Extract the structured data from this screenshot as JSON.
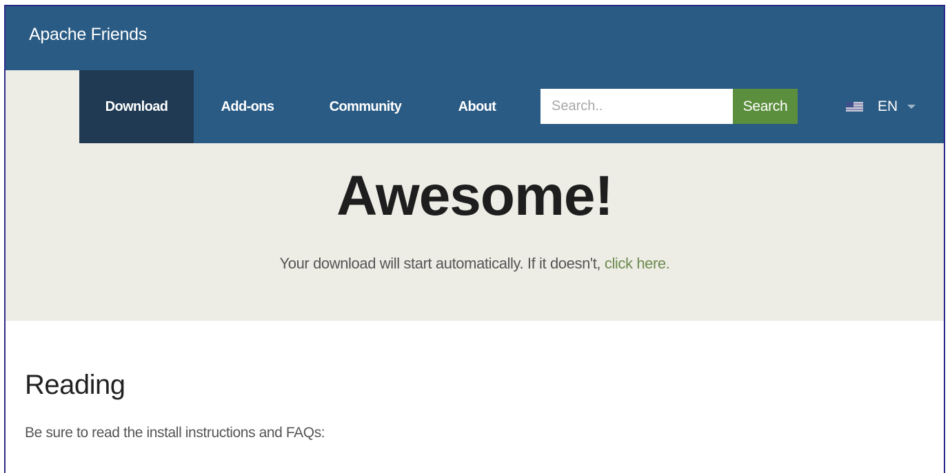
{
  "header": {
    "brand": "Apache Friends"
  },
  "nav": {
    "items": [
      {
        "label": "Download",
        "active": true
      },
      {
        "label": "Add-ons",
        "active": false
      },
      {
        "label": "Community",
        "active": false
      },
      {
        "label": "About",
        "active": false
      }
    ],
    "search": {
      "placeholder": "Search..",
      "value": "",
      "button_label": "Search"
    },
    "language": {
      "icon": "us-flag-icon",
      "label": "EN"
    }
  },
  "hero": {
    "title": "Awesome!",
    "text": "Your download will start automatically. If it doesn't,",
    "link_text": "click here."
  },
  "content": {
    "title": "Reading",
    "text": "Be sure to read the install instructions and FAQs:"
  },
  "colors": {
    "header_bg": "#2a5b84",
    "nav_active_bg": "#1f3a52",
    "search_button_bg": "#5b8f3d",
    "hero_bg": "#edece5",
    "link": "#6c8a4e"
  }
}
